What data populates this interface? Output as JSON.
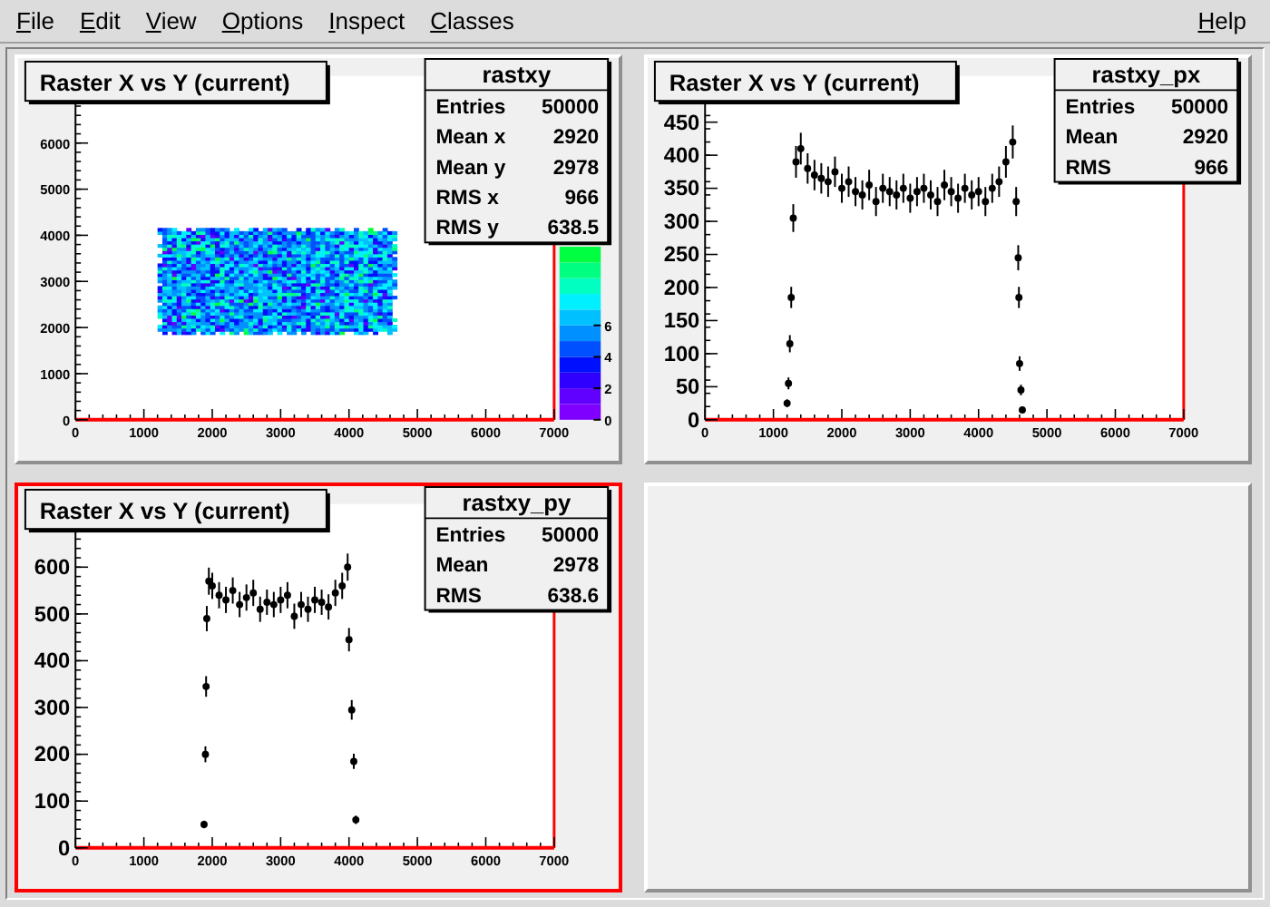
{
  "menu": [
    {
      "label": "File"
    },
    {
      "label": "Edit"
    },
    {
      "label": "View"
    },
    {
      "label": "Options"
    },
    {
      "label": "Inspect"
    },
    {
      "label": "Classes"
    }
  ],
  "help": {
    "label": "Help"
  },
  "pads": [
    {
      "kind": "hist2d",
      "selected": false,
      "title": "Raster X vs Y (current)",
      "stats": {
        "name": "rastxy",
        "rows": [
          {
            "label": "Entries",
            "value": "50000"
          },
          {
            "label": "Mean x",
            "value": "2920"
          },
          {
            "label": "Mean y",
            "value": "2978"
          },
          {
            "label": "RMS x",
            "value": "966"
          },
          {
            "label": "RMS y",
            "value": "638.5"
          }
        ]
      },
      "x_ticks": [
        "0",
        "1000",
        "2000",
        "3000",
        "4000",
        "5000",
        "6000",
        "7000"
      ],
      "y_ticks": [
        "6000",
        "5000",
        "4000",
        "3000",
        "2000",
        "1000",
        "0"
      ],
      "palette_ticks": [
        "6",
        "4",
        "2",
        "0"
      ]
    },
    {
      "kind": "hist1d",
      "selected": false,
      "title": "Raster X vs Y (current)",
      "stats": {
        "name": "rastxy_px",
        "rows": [
          {
            "label": "Entries",
            "value": "50000"
          },
          {
            "label": "Mean",
            "value": "2920"
          },
          {
            "label": "RMS",
            "value": "966"
          }
        ]
      },
      "chart_data": {
        "type": "scatter",
        "xlim": [
          0,
          7000
        ],
        "ylim": [
          0,
          520
        ],
        "xticks": [
          {
            "value": 0,
            "label": "0"
          },
          {
            "value": 1000,
            "label": "1000"
          },
          {
            "value": 2000,
            "label": "2000"
          },
          {
            "value": 3000,
            "label": "3000"
          },
          {
            "value": 4000,
            "label": "4000"
          },
          {
            "value": 5000,
            "label": "5000"
          },
          {
            "value": 6000,
            "label": "6000"
          },
          {
            "value": 7000,
            "label": "7000"
          }
        ],
        "yticks": [
          {
            "value": 0,
            "label": "0"
          },
          {
            "value": 50,
            "label": "50"
          },
          {
            "value": 100,
            "label": "100"
          },
          {
            "value": 150,
            "label": "150"
          },
          {
            "value": 200,
            "label": "200"
          },
          {
            "value": 250,
            "label": "250"
          },
          {
            "value": 300,
            "label": "300"
          },
          {
            "value": 350,
            "label": "350"
          },
          {
            "value": 400,
            "label": "400"
          },
          {
            "value": 450,
            "label": "450"
          }
        ],
        "x": [
          1200,
          1220,
          1240,
          1260,
          1290,
          1330,
          1400,
          1500,
          1600,
          1700,
          1800,
          1900,
          2000,
          2100,
          2200,
          2300,
          2400,
          2500,
          2600,
          2700,
          2800,
          2900,
          3000,
          3100,
          3200,
          3300,
          3400,
          3500,
          3600,
          3700,
          3800,
          3900,
          4000,
          4100,
          4200,
          4300,
          4400,
          4500,
          4550,
          4580,
          4590,
          4600,
          4620,
          4640
        ],
        "values": [
          25,
          55,
          115,
          185,
          305,
          390,
          410,
          380,
          370,
          365,
          360,
          375,
          350,
          360,
          345,
          340,
          355,
          330,
          350,
          345,
          340,
          350,
          335,
          345,
          350,
          340,
          330,
          355,
          345,
          335,
          350,
          340,
          345,
          330,
          350,
          360,
          390,
          420,
          330,
          245,
          185,
          85,
          45,
          15
        ],
        "errors": [
          6,
          9,
          13,
          16,
          21,
          24,
          24,
          23,
          23,
          23,
          23,
          23,
          22,
          23,
          22,
          22,
          23,
          22,
          22,
          22,
          22,
          22,
          22,
          22,
          22,
          22,
          22,
          23,
          22,
          22,
          22,
          22,
          22,
          22,
          22,
          23,
          24,
          25,
          22,
          19,
          16,
          11,
          8,
          5
        ]
      }
    },
    {
      "kind": "hist1d",
      "selected": true,
      "title": "Raster X vs Y (current)",
      "stats": {
        "name": "rastxy_py",
        "rows": [
          {
            "label": "Entries",
            "value": "50000"
          },
          {
            "label": "Mean",
            "value": "2978"
          },
          {
            "label": "RMS",
            "value": "638.6"
          }
        ]
      },
      "chart_data": {
        "type": "scatter",
        "xlim": [
          0,
          7000
        ],
        "ylim": [
          0,
          735
        ],
        "xticks": [
          {
            "value": 0,
            "label": "0"
          },
          {
            "value": 1000,
            "label": "1000"
          },
          {
            "value": 2000,
            "label": "2000"
          },
          {
            "value": 3000,
            "label": "3000"
          },
          {
            "value": 4000,
            "label": "4000"
          },
          {
            "value": 5000,
            "label": "5000"
          },
          {
            "value": 6000,
            "label": "6000"
          },
          {
            "value": 7000,
            "label": "7000"
          }
        ],
        "yticks": [
          {
            "value": 0,
            "label": "0"
          },
          {
            "value": 100,
            "label": "100"
          },
          {
            "value": 200,
            "label": "200"
          },
          {
            "value": 300,
            "label": "300"
          },
          {
            "value": 400,
            "label": "400"
          },
          {
            "value": 500,
            "label": "500"
          },
          {
            "value": 600,
            "label": "600"
          }
        ],
        "x": [
          1880,
          1900,
          1910,
          1920,
          1950,
          2000,
          2100,
          2200,
          2300,
          2400,
          2500,
          2600,
          2700,
          2800,
          2900,
          3000,
          3100,
          3200,
          3300,
          3400,
          3500,
          3600,
          3700,
          3800,
          3900,
          3980,
          4000,
          4040,
          4070,
          4100
        ],
        "values": [
          50,
          200,
          345,
          490,
          570,
          560,
          540,
          530,
          550,
          520,
          535,
          545,
          510,
          525,
          520,
          530,
          540,
          495,
          520,
          510,
          530,
          525,
          515,
          545,
          560,
          600,
          445,
          295,
          185,
          60
        ],
        "errors": [
          8,
          17,
          22,
          27,
          29,
          28,
          28,
          28,
          28,
          27,
          28,
          28,
          27,
          27,
          27,
          28,
          28,
          27,
          27,
          27,
          28,
          27,
          27,
          28,
          28,
          29,
          25,
          21,
          16,
          9
        ]
      }
    },
    {
      "kind": "empty",
      "selected": false
    }
  ]
}
